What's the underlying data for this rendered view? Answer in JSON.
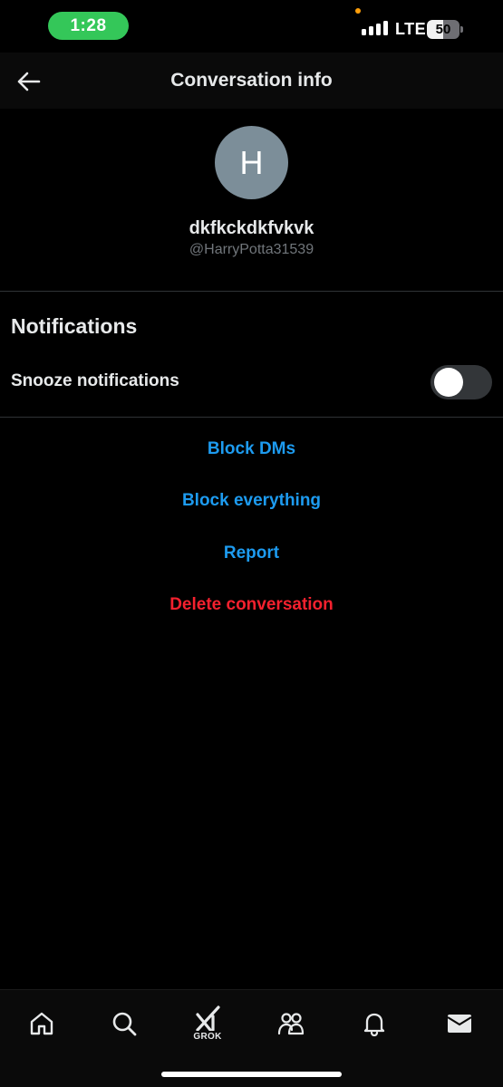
{
  "status_bar": {
    "time": "1:28",
    "network": "LTE",
    "battery": "50",
    "battery_level_percent": 50,
    "time_pill_color": "#34c759"
  },
  "header": {
    "title": "Conversation info",
    "back_icon": "arrow-left-icon"
  },
  "profile": {
    "avatar_initial": "H",
    "display_name": "dkfkckdkfvkvk",
    "handle": "@HarryPotta31539",
    "avatar_color": "#7c8e99"
  },
  "notifications": {
    "title": "Notifications",
    "snooze_label": "Snooze notifications",
    "snooze_enabled": false
  },
  "actions": {
    "block_dms": "Block DMs",
    "block_everything": "Block everything",
    "report": "Report",
    "delete_conversation": "Delete conversation",
    "accent_color": "#1d9bf0",
    "danger_color": "#f4212e"
  },
  "bottom_nav": {
    "items": [
      {
        "icon": "home-icon"
      },
      {
        "icon": "search-icon"
      },
      {
        "icon": "grok-icon",
        "label": "GROK"
      },
      {
        "icon": "communities-icon"
      },
      {
        "icon": "bell-icon"
      },
      {
        "icon": "mail-icon"
      }
    ]
  }
}
